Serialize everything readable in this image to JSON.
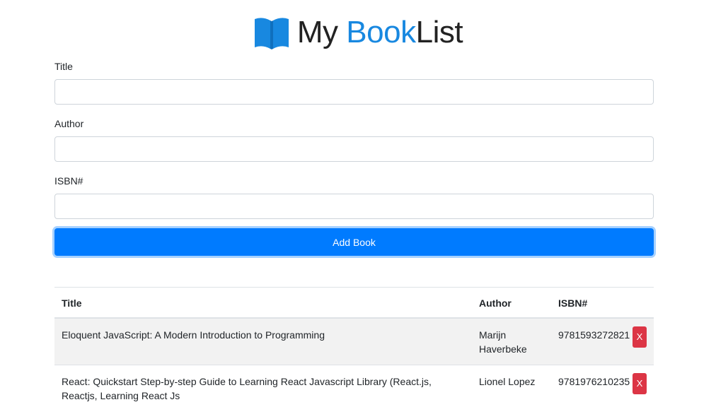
{
  "header": {
    "brand_part1": "My ",
    "brand_part2": "Book",
    "brand_part3": "List",
    "logo_icon": "open-book-icon",
    "accent_color": "#1888e0"
  },
  "form": {
    "title_label": "Title",
    "title_value": "",
    "author_label": "Author",
    "author_value": "",
    "isbn_label": "ISBN#",
    "isbn_value": "",
    "add_button_label": "Add Book",
    "button_color": "#007bff"
  },
  "table": {
    "columns": [
      "Title",
      "Author",
      "ISBN#",
      ""
    ],
    "rows": [
      {
        "title": "Eloquent JavaScript: A Modern Introduction to Programming",
        "author": "Marijn Haverbeke",
        "isbn": "9781593272821",
        "delete_label": "X"
      },
      {
        "title": "React: Quickstart Step-by-step Guide to Learning React Javascript Library (React.js, Reactjs, Learning React Js",
        "author": "Lionel Lopez",
        "isbn": "9781976210235",
        "delete_label": "X"
      }
    ],
    "delete_color": "#dc3545"
  }
}
